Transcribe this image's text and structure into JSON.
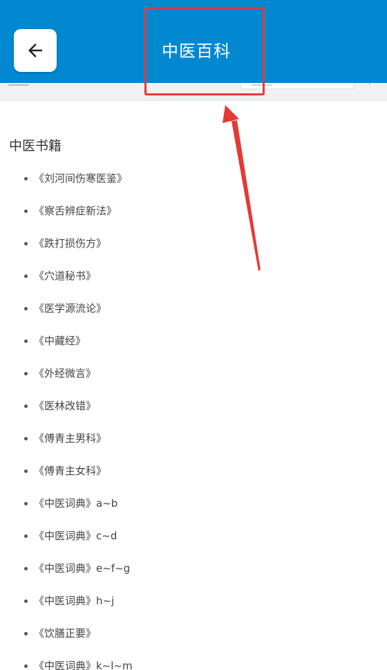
{
  "header": {
    "title": "中医百科",
    "back_icon": "arrow-left-icon",
    "background": "#0288d1"
  },
  "annotation": {
    "color": "#e53935"
  },
  "section": {
    "title": "中医书籍"
  },
  "books": [
    "《刘河间伤寒医鉴》",
    "《察舌辨症新法》",
    "《跌打损伤方》",
    "《穴道秘书》",
    "《医学源流论》",
    "《中藏经》",
    "《外经微言》",
    "《医林改错》",
    "《傅青主男科》",
    "《傅青主女科》",
    "《中医词典》a~b",
    "《中医词典》c~d",
    "《中医词典》e~f~g",
    "《中医词典》h~j",
    "《饮膳正要》",
    "《中医词典》k~l~m"
  ]
}
